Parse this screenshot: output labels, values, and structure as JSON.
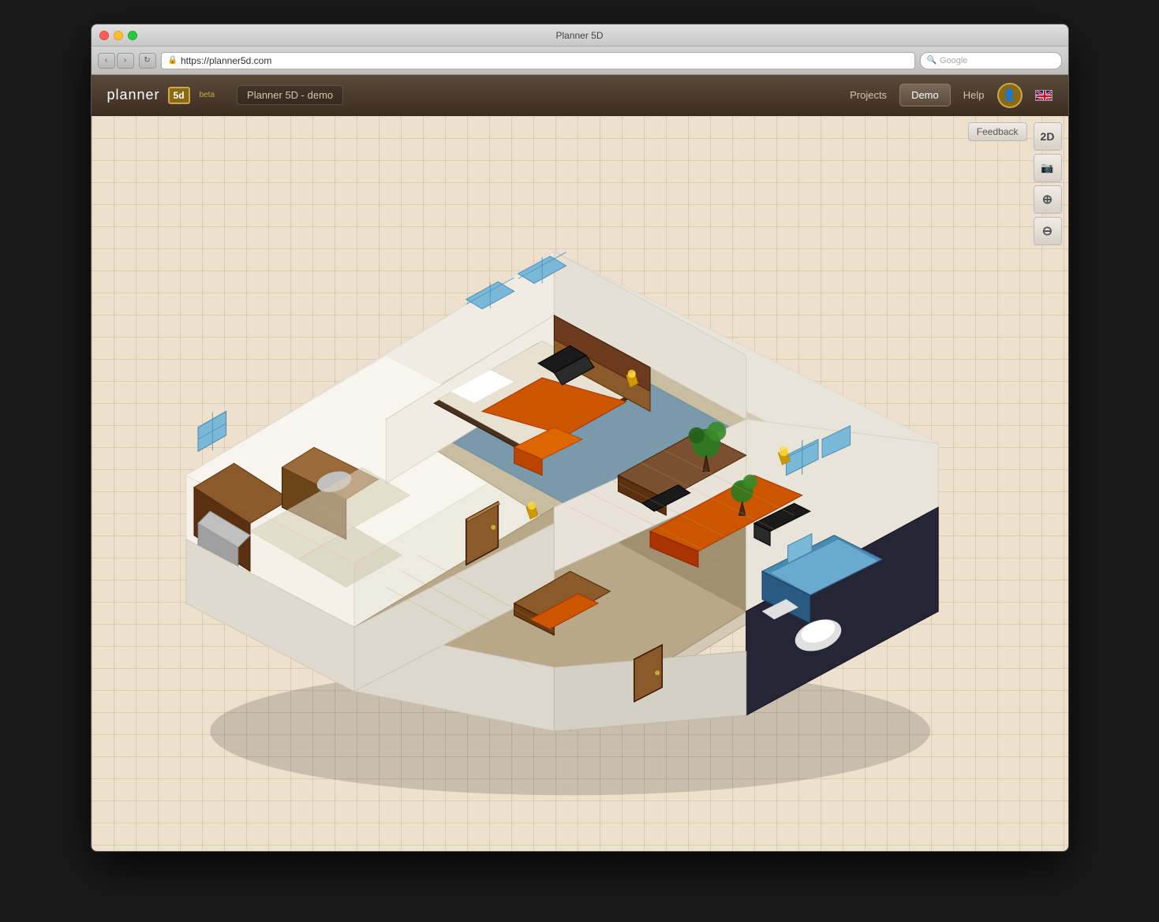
{
  "window": {
    "title": "Planner 5D",
    "url": "https://planner5d.com"
  },
  "browser": {
    "title": "Planner 5D",
    "url_display": "https://planner5d.com",
    "url_placeholder": "https://planner5d.com",
    "search_placeholder": "Google",
    "back_label": "‹",
    "forward_label": "›",
    "reload_label": "↻"
  },
  "header": {
    "logo_text": "planner",
    "logo_suffix": "5d",
    "beta_label": "beta",
    "project_name": "Planner 5D - demo",
    "nav": {
      "projects_label": "Projects",
      "demo_label": "Demo",
      "help_label": "Help"
    },
    "flag_alt": "UK flag"
  },
  "toolbar": {
    "feedback_label": "Feedback",
    "view_2d_label": "2D",
    "screenshot_icon": "camera",
    "zoom_in_icon": "magnify-plus",
    "zoom_out_icon": "magnify-minus"
  },
  "colors": {
    "header_bg": "#3d2e22",
    "canvas_bg": "#ede0cc",
    "grid_line": "#c8b89a",
    "wall_color": "#f5f0e8",
    "floor_kitchen": "#d4c9b0",
    "floor_bedroom": "#8b7355",
    "floor_office": "#a0856a",
    "floor_bathroom": "#1a1a2e",
    "accent_orange": "#cc5500",
    "wood_brown": "#6b3a1f",
    "sky_blue": "#4a90b8",
    "feedback_bg": "#e8e0d4"
  }
}
